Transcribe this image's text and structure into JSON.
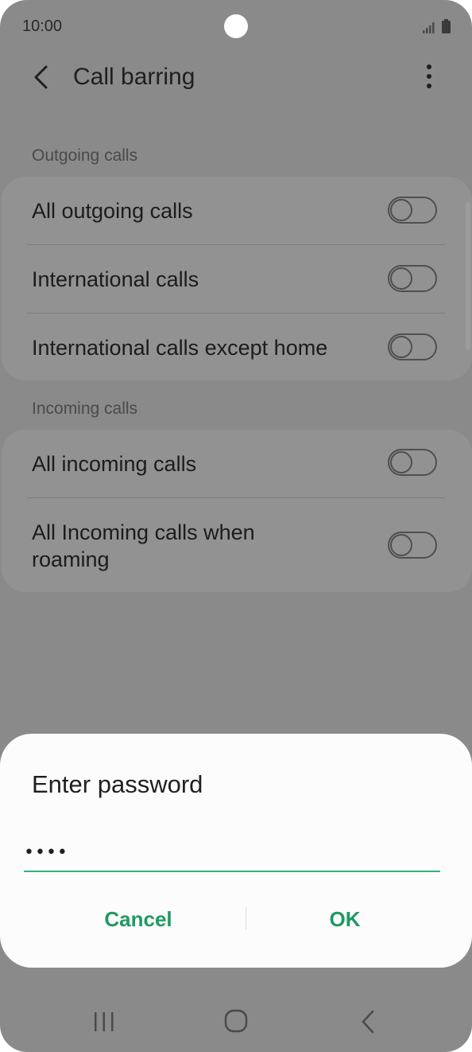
{
  "status_bar": {
    "time": "10:00",
    "icons": [
      "signal-icon",
      "battery-icon"
    ]
  },
  "header": {
    "title": "Call barring",
    "back_icon": "back-arrow-icon",
    "more_icon": "more-vertical-icon"
  },
  "sections": [
    {
      "label": "Outgoing calls",
      "items": [
        {
          "label": "All outgoing calls",
          "enabled": false
        },
        {
          "label": "International calls",
          "enabled": false
        },
        {
          "label": "International calls except home",
          "enabled": false
        }
      ]
    },
    {
      "label": "Incoming calls",
      "items": [
        {
          "label": "All incoming calls",
          "enabled": false
        },
        {
          "label_line1": "All Incoming calls when",
          "label_line2": "roaming",
          "enabled": false
        }
      ]
    }
  ],
  "dialog": {
    "title": "Enter password",
    "password_value": "••••",
    "cancel_label": "Cancel",
    "ok_label": "OK"
  },
  "colors": {
    "accent": "#1f9a62",
    "input_underline": "#2fb47a",
    "overlay_background": "#8a8a8a",
    "dialog_background": "#fcfcfc"
  },
  "nav_bar": {
    "icons": [
      "recents-icon",
      "home-icon",
      "back-icon"
    ]
  }
}
